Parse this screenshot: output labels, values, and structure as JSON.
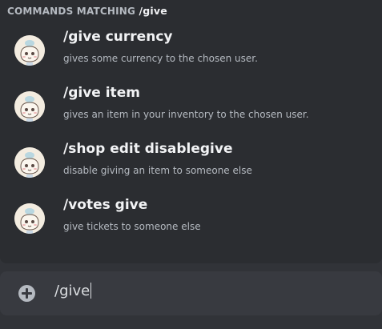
{
  "autocomplete": {
    "header_prefix": "COMMANDS MATCHING",
    "header_query": "/give",
    "commands": [
      {
        "name": "/give currency",
        "description": "gives some currency to the chosen user.",
        "icon": "bot-avatar-icon"
      },
      {
        "name": "/give item",
        "description": "gives an item in your inventory to the chosen user.",
        "icon": "bot-avatar-icon"
      },
      {
        "name": "/shop edit disablegive",
        "description": "disable giving an item to someone else",
        "icon": "bot-avatar-icon"
      },
      {
        "name": "/votes give",
        "description": "give tickets to someone else",
        "icon": "bot-avatar-icon"
      }
    ]
  },
  "composer": {
    "attach_icon": "plus-circle-icon",
    "value": "/give"
  },
  "colors": {
    "background": "#313338",
    "popup": "#2b2d31",
    "input": "#383a40",
    "text_primary": "#f2f3f5",
    "text_muted": "#b5bac1"
  }
}
